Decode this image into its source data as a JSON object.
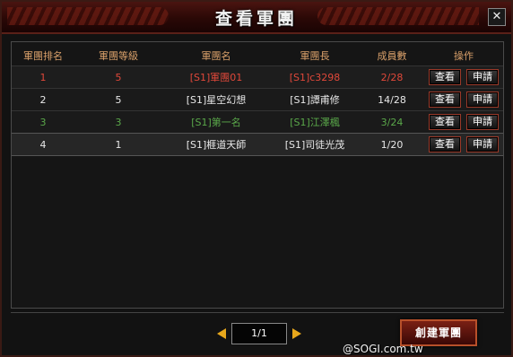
{
  "window": {
    "title": "查看軍團",
    "close_label": "✕"
  },
  "table": {
    "headers": [
      "軍團排名",
      "軍團等級",
      "軍團名",
      "軍團長",
      "成員數",
      "操作"
    ],
    "rows": [
      {
        "rank": "1",
        "level": "5",
        "name": "[S1]軍團01",
        "leader": "[S1]c3298",
        "members": "2/28",
        "color": "red"
      },
      {
        "rank": "2",
        "level": "5",
        "name": "[S1]星空幻想",
        "leader": "[S1]譚甫修",
        "members": "14/28",
        "color": "white"
      },
      {
        "rank": "3",
        "level": "3",
        "name": "[S1]第一名",
        "leader": "[S1]江澤楓",
        "members": "3/24",
        "color": "green"
      },
      {
        "rank": "4",
        "level": "1",
        "name": "[S1]榧道天師",
        "leader": "[S1]司徒光茂",
        "members": "1/20",
        "color": "white"
      }
    ],
    "view_label": "查看",
    "apply_label": "申請"
  },
  "pager": {
    "page": "1/1"
  },
  "footer": {
    "create_label": "創建軍團"
  },
  "watermark": "@SOGI.com.tw",
  "colors": {
    "red": "#e0483a",
    "green": "#5aa84a",
    "header": "#d9a06a"
  }
}
